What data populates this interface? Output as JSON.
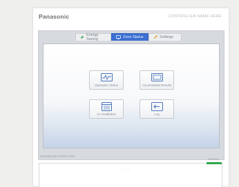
{
  "header": {
    "brand": "Panasonic",
    "model_text": "CONTROLLER NAME HERE"
  },
  "tabs": [
    {
      "label": "Energy Saving",
      "icon": "leaf-icon",
      "selected": false
    },
    {
      "label": "Zone Status",
      "icon": "monitor-icon",
      "selected": true
    },
    {
      "label": "Settings",
      "icon": "wrench-icon",
      "selected": false
    }
  ],
  "tiles": [
    {
      "label": "Operation Status",
      "icon": "pulse-monitor-icon"
    },
    {
      "label": "Accumulated Results",
      "icon": "display-icon"
    },
    {
      "label": "Air Installation",
      "icon": "calendar-icon"
    },
    {
      "label": "Log",
      "icon": "log-arrow-icon"
    }
  ],
  "status_bar": {
    "text": "DISABLED FUNCTION"
  },
  "lower_panel": {
    "badge": "NORMAL",
    "center_text": "- - -"
  },
  "colors": {
    "tab_active": "#3d6fd0",
    "accent_green": "#2fa84a"
  }
}
